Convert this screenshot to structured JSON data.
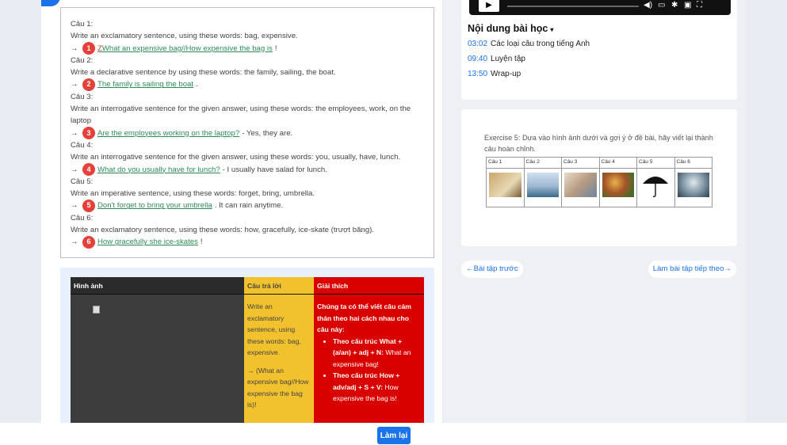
{
  "exercise": {
    "items": [
      {
        "label": "Câu 1:",
        "prompt": "Write an exclamatory sentence, using these words: bag, expensive.",
        "num": "1",
        "answer": "ZWhat an expensive bag//How expensive the bag is",
        "tail": "!"
      },
      {
        "label": "Câu 2:",
        "prompt": "Write a declarative sentence by using these words: the family, sailing, the boat.",
        "num": "2",
        "answer": "The family is sailing the boat",
        "tail": "."
      },
      {
        "label": "Câu 3:",
        "prompt": "Write an interrogative sentence for the given answer, using these words: the employees, work, on the laptop",
        "num": "3",
        "answer": "Are the employees working on the laptop?",
        "tail": "- Yes, they are."
      },
      {
        "label": "Câu 4:",
        "prompt": "Write an interrogative sentence for the given answer, using these words: you, usually, have, lunch.",
        "num": "4",
        "answer": "What do you usually have for lunch?",
        "tail": "- I usually have salad for lunch."
      },
      {
        "label": "Câu 5:",
        "prompt": "Write an imperative sentence, using these words: forget, bring, umbrella.",
        "num": "5",
        "answer": "Don't forget to bring your umbrella",
        "tail": ". It can rain anytime."
      },
      {
        "label": "Câu 6:",
        "prompt": "Write an exclamatory sentence, using these words: how, gracefully, ice-skate (trượt băng).",
        "num": "6",
        "answer": "How gracefully she ice-skates",
        "tail": "!"
      }
    ],
    "arrow": "→"
  },
  "explain_table": {
    "headers": {
      "image": "Hình ảnh",
      "answer": "Câu trả lời",
      "explain": "Giải thích"
    },
    "answer_lines": [
      "Write an exclamatory sentence, using these words: bag, expensive.",
      "→ (What an expensive bag//How expensive the bag is)!"
    ],
    "explain_intro": "Chúng ta có thể viết câu cảm thán theo hai cách nhau cho câu này:",
    "bullet1_bold": "Theo cấu trúc What + (a/an) + adj + N:",
    "bullet1_rest": " What an expensive bag!",
    "bullet2_bold": "Theo cấu trúc How + adv/adj + S + V:",
    "bullet2_rest": " How expensive the bag is!"
  },
  "lesson": {
    "title": "Nội dung bài học",
    "chevron": "▾",
    "toc": [
      {
        "time": "03:02",
        "label": "Các loại câu trong tiếng Anh"
      },
      {
        "time": "09:40",
        "label": "Luyện tập"
      },
      {
        "time": "13:50",
        "label": "Wrap-up"
      }
    ]
  },
  "exercise5": {
    "text": "Exercise 5: Dựa vào hình ảnh dưới và gợi ý ở đề bài, hãy viết lại thành câu hoàn chỉnh.",
    "cols": [
      "Câu 1",
      "Câu 2",
      "Câu 3",
      "Câu 4",
      "Câu 5",
      "Câu 6"
    ]
  },
  "nav": {
    "prev": "←Bài tập trước",
    "next": "Làm bài tập tiếp theo→"
  },
  "footer": {
    "redo": "Làm lại"
  },
  "colors": {
    "accent": "#1a73e8",
    "badge": "#e5413a",
    "answer_green": "#2e8b57",
    "yellow": "#f2c12e",
    "red": "#d90000"
  }
}
